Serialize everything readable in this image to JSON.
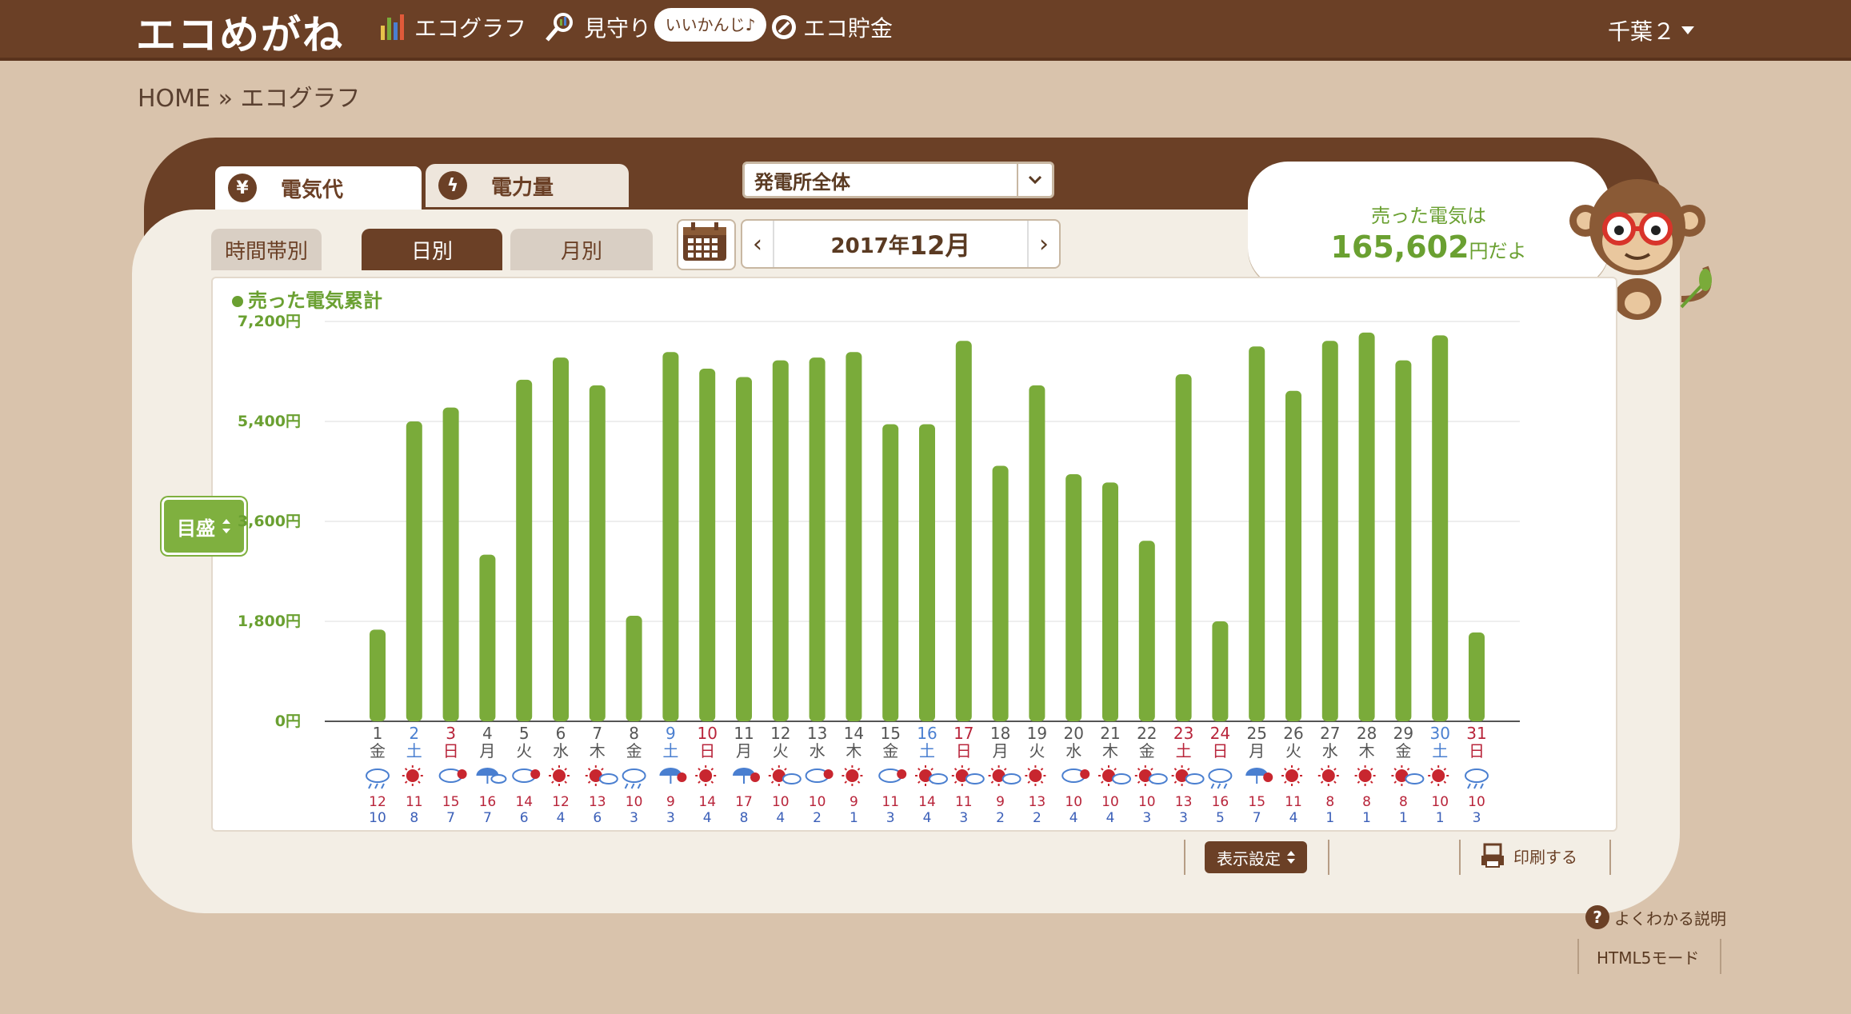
{
  "header": {
    "brand": "エコめがね",
    "nav": [
      {
        "label": "エコグラフ",
        "icon": "bar-chart-icon"
      },
      {
        "label": "見守り",
        "icon": "magnifier-icon"
      },
      {
        "label": "エコ貯金",
        "icon": "coin-icon"
      }
    ],
    "pill": "いいかんじ♪",
    "user": "千葉２"
  },
  "breadcrumb": {
    "home": "HOME",
    "sep": "»",
    "current": "エコグラフ"
  },
  "tabs_top": [
    {
      "label": "電気代",
      "icon": "yen-icon",
      "active": true
    },
    {
      "label": "電力量",
      "icon": "lightning-icon",
      "active": false
    }
  ],
  "plant_select": {
    "value": "発電所全体"
  },
  "tabs_period": [
    {
      "label": "時間帯別",
      "active": false
    },
    {
      "label": "日別",
      "active": true
    },
    {
      "label": "月別",
      "active": false
    }
  ],
  "month_nav": {
    "year_prefix": "2017年",
    "month": "12月",
    "prev": "‹",
    "next": "›"
  },
  "bubble": {
    "line1": "売った電気は",
    "amount": "165,602",
    "suffix": "円だよ"
  },
  "controls": {
    "meyasu": "目盛",
    "display": "表示設定",
    "print": "印刷する",
    "help": "よくわかる説明",
    "html5": "HTML5モード"
  },
  "colors": {
    "bar": "#7aab3a",
    "brown": "#6b4026",
    "sat": "#4a7fd0",
    "sun": "#b8243a",
    "high": "#b8243a",
    "low": "#3b5fb8"
  },
  "chart_data": {
    "type": "bar",
    "title": "売った電気累計",
    "ylim": [
      0,
      7200
    ],
    "yticks": [
      {
        "v": 0,
        "label": "0円"
      },
      {
        "v": 1800,
        "label": "1,800円"
      },
      {
        "v": 3600,
        "label": "3,600円"
      },
      {
        "v": 5400,
        "label": "5,400円"
      },
      {
        "v": 7200,
        "label": "7,200円"
      }
    ],
    "grid": true,
    "days": [
      {
        "d": "1",
        "w": "金",
        "t": "n",
        "v": 1650,
        "wx": "cloud-rain",
        "hi": "12",
        "lo": "10"
      },
      {
        "d": "2",
        "w": "土",
        "t": "sat",
        "v": 5400,
        "wx": "sun",
        "hi": "11",
        "lo": "8"
      },
      {
        "d": "3",
        "w": "日",
        "t": "sun",
        "v": 5650,
        "wx": "cloud-sun",
        "hi": "15",
        "lo": "7"
      },
      {
        "d": "4",
        "w": "月",
        "t": "n",
        "v": 3000,
        "wx": "rain-cloud",
        "hi": "16",
        "lo": "7"
      },
      {
        "d": "5",
        "w": "火",
        "t": "n",
        "v": 6150,
        "wx": "cloud-sun",
        "hi": "14",
        "lo": "6"
      },
      {
        "d": "6",
        "w": "水",
        "t": "n",
        "v": 6550,
        "wx": "sun",
        "hi": "12",
        "lo": "4"
      },
      {
        "d": "7",
        "w": "木",
        "t": "n",
        "v": 6050,
        "wx": "sun-cloud",
        "hi": "13",
        "lo": "6"
      },
      {
        "d": "8",
        "w": "金",
        "t": "n",
        "v": 1900,
        "wx": "cloud-rain",
        "hi": "10",
        "lo": "3"
      },
      {
        "d": "9",
        "w": "土",
        "t": "sat",
        "v": 6650,
        "wx": "rain-sun",
        "hi": "9",
        "lo": "3"
      },
      {
        "d": "10",
        "w": "日",
        "t": "sun",
        "v": 6350,
        "wx": "sun",
        "hi": "14",
        "lo": "4"
      },
      {
        "d": "11",
        "w": "月",
        "t": "n",
        "v": 6200,
        "wx": "rain-sun",
        "hi": "17",
        "lo": "8"
      },
      {
        "d": "12",
        "w": "火",
        "t": "n",
        "v": 6500,
        "wx": "sun-cloud",
        "hi": "10",
        "lo": "4"
      },
      {
        "d": "13",
        "w": "水",
        "t": "n",
        "v": 6550,
        "wx": "cloud-sun",
        "hi": "10",
        "lo": "2"
      },
      {
        "d": "14",
        "w": "木",
        "t": "n",
        "v": 6650,
        "wx": "sun",
        "hi": "9",
        "lo": "1"
      },
      {
        "d": "15",
        "w": "金",
        "t": "n",
        "v": 5350,
        "wx": "cloud-sun",
        "hi": "11",
        "lo": "3"
      },
      {
        "d": "16",
        "w": "土",
        "t": "sat",
        "v": 5350,
        "wx": "sun-cloud",
        "hi": "14",
        "lo": "4"
      },
      {
        "d": "17",
        "w": "日",
        "t": "sun",
        "v": 6850,
        "wx": "sun-cloud",
        "hi": "11",
        "lo": "3"
      },
      {
        "d": "18",
        "w": "月",
        "t": "n",
        "v": 4600,
        "wx": "sun-cloud",
        "hi": "9",
        "lo": "2"
      },
      {
        "d": "19",
        "w": "火",
        "t": "n",
        "v": 6050,
        "wx": "sun",
        "hi": "13",
        "lo": "2"
      },
      {
        "d": "20",
        "w": "水",
        "t": "n",
        "v": 4450,
        "wx": "cloud-sun",
        "hi": "10",
        "lo": "4"
      },
      {
        "d": "21",
        "w": "木",
        "t": "n",
        "v": 4300,
        "wx": "sun-cloud",
        "hi": "10",
        "lo": "4"
      },
      {
        "d": "22",
        "w": "金",
        "t": "n",
        "v": 3250,
        "wx": "sun-cloud",
        "hi": "10",
        "lo": "3"
      },
      {
        "d": "23",
        "w": "土",
        "t": "sun",
        "v": 6250,
        "wx": "sun-cloud",
        "hi": "13",
        "lo": "3"
      },
      {
        "d": "24",
        "w": "日",
        "t": "sun",
        "v": 1800,
        "wx": "cloud-rain",
        "hi": "16",
        "lo": "5"
      },
      {
        "d": "25",
        "w": "月",
        "t": "n",
        "v": 6750,
        "wx": "rain-sun",
        "hi": "15",
        "lo": "7"
      },
      {
        "d": "26",
        "w": "火",
        "t": "n",
        "v": 5950,
        "wx": "sun",
        "hi": "11",
        "lo": "4"
      },
      {
        "d": "27",
        "w": "水",
        "t": "n",
        "v": 6850,
        "wx": "sun",
        "hi": "8",
        "lo": "1"
      },
      {
        "d": "28",
        "w": "木",
        "t": "n",
        "v": 7000,
        "wx": "sun",
        "hi": "8",
        "lo": "1"
      },
      {
        "d": "29",
        "w": "金",
        "t": "n",
        "v": 6500,
        "wx": "sun-cloud",
        "hi": "8",
        "lo": "1"
      },
      {
        "d": "30",
        "w": "土",
        "t": "sat",
        "v": 6950,
        "wx": "sun",
        "hi": "10",
        "lo": "1"
      },
      {
        "d": "31",
        "w": "日",
        "t": "sun",
        "v": 1600,
        "wx": "cloud-rain",
        "hi": "10",
        "lo": "3"
      }
    ]
  }
}
